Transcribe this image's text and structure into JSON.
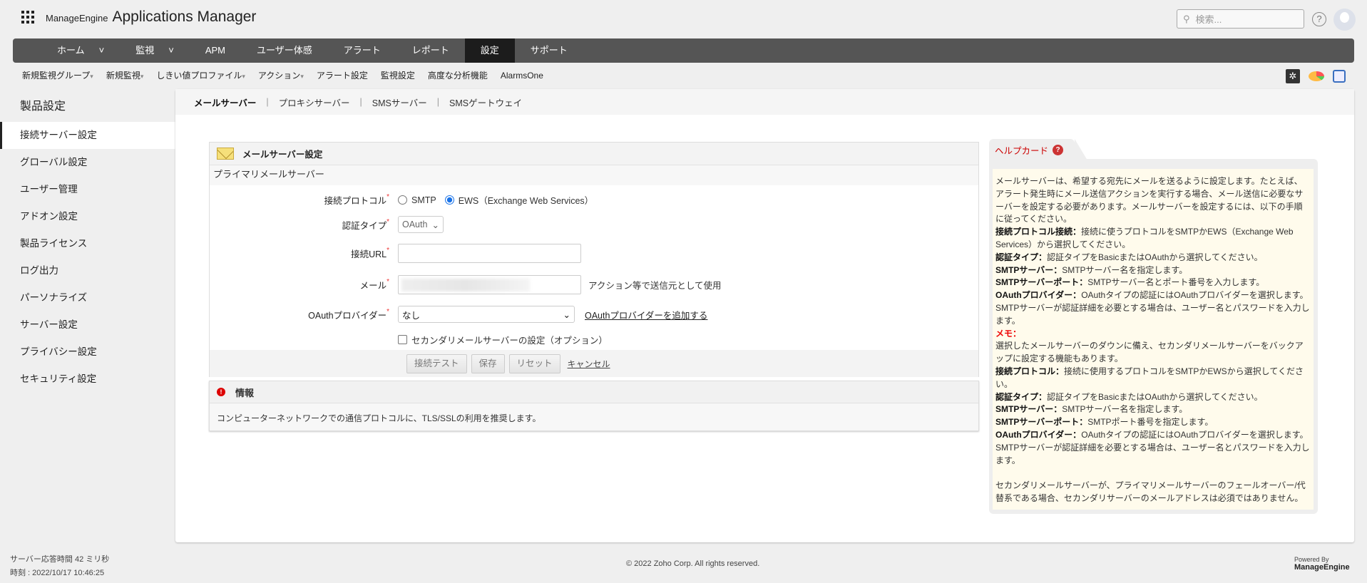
{
  "header": {
    "brand": "ManageEngine",
    "product": "Applications Manager",
    "search_placeholder": "検索...",
    "help": "?"
  },
  "nav": [
    {
      "label": "ホーム",
      "caret": "˅"
    },
    {
      "label": "監視",
      "caret": "˅"
    },
    {
      "label": "APM"
    },
    {
      "label": "ユーザー体感"
    },
    {
      "label": "アラート"
    },
    {
      "label": "レポート"
    },
    {
      "label": "設定",
      "active": true
    },
    {
      "label": "サポート"
    }
  ],
  "submenu": [
    {
      "label": "新規監視グループ",
      "caret": "▾"
    },
    {
      "label": "新規監視",
      "caret": "▾"
    },
    {
      "label": "しきい値プロファイル",
      "caret": "▾"
    },
    {
      "label": "アクション",
      "caret": "▾"
    },
    {
      "label": "アラート設定"
    },
    {
      "label": "監視設定"
    },
    {
      "label": "高度な分析機能"
    },
    {
      "label": "AlarmsOne"
    }
  ],
  "sidebar": {
    "title": "製品設定",
    "items": [
      "接続サーバー設定",
      "グローバル設定",
      "ユーザー管理",
      "アドオン設定",
      "製品ライセンス",
      "ログ出力",
      "パーソナライズ",
      "サーバー設定",
      "プライバシー設定",
      "セキュリティ設定"
    ]
  },
  "tabs": [
    "メールサーバー",
    "プロキシサーバー",
    "SMSサーバー",
    "SMSゲートウェイ"
  ],
  "tab_sep": "|",
  "form": {
    "title": "メールサーバー設定",
    "section": "プライマリメールサーバー",
    "required": "*",
    "protocol_label": "接続プロトコル",
    "protocol_smtp": "SMTP",
    "protocol_ews": "EWS（Exchange Web Services）",
    "auth_label": "認証タイプ",
    "auth_value": "OAuth",
    "caret": "⌄",
    "url_label": "接続URL",
    "mail_label": "メール",
    "mail_hint": "アクション等で送信元として使用",
    "oauth_label": "OAuthプロバイダー",
    "oauth_value": "なし",
    "oauth_add": "OAuthプロバイダーを追加する",
    "secondary": "セカンダリメールサーバーの設定（オプション）",
    "buttons": {
      "test": "接続テスト",
      "save": "保存",
      "reset": "リセット",
      "cancel": "キャンセル"
    }
  },
  "info": {
    "title": "情報",
    "icon": "!",
    "text": "コンピューターネットワークでの通信プロトコルに、TLS/SSLの利用を推奨します。"
  },
  "helpcard": {
    "title": "ヘルプカード",
    "icon": "?",
    "paras": [
      {
        "t": "メールサーバーは、希望する宛先にメールを送るように設定します。たとえば、アラート発生時にメール送信アクションを実行する場合、メール送信に必要なサーバーを設定する必要があります。メールサーバーを設定するには、以下の手順に従ってください。"
      },
      {
        "b": "接続プロトコル接続：",
        "t": "接続に使うプロトコルをSMTPかEWS（Exchange Web Services）から選択してください。"
      },
      {
        "b": "認証タイプ：",
        "t": "認証タイプをBasicまたはOAuthから選択してください。"
      },
      {
        "b": "SMTPサーバー：",
        "t": "SMTPサーバー名を指定します。"
      },
      {
        "b": "SMTPサーバーポート：",
        "t": "SMTPサーバー名とポート番号を入力します。"
      },
      {
        "b": "OAuthプロバイダー：",
        "t": "OAuthタイプの認証にはOAuthプロバイダーを選択します。SMTPサーバーが認証詳細を必要とする場合は、ユーザー名とパスワードを入力します。"
      },
      {
        "r": "メモ："
      },
      {
        "t": "選択したメールサーバーのダウンに備え、セカンダリメールサーバーをバックアップに設定する機能もあります。"
      },
      {
        "b": "接続プロトコル：",
        "t": "接続に使用するプロトコルをSMTPかEWSから選択してください。"
      },
      {
        "b": "認証タイプ：",
        "t": "認証タイプをBasicまたはOAuthから選択してください。"
      },
      {
        "b": "SMTPサーバー：",
        "t": "SMTPサーバー名を指定します。"
      },
      {
        "b": "SMTPサーバーポート：",
        "t": "SMTPポート番号を指定します。"
      },
      {
        "b": "OAuthプロバイダー：",
        "t": "OAuthタイプの認証にはOAuthプロバイダーを選択します。SMTPサーバーが認証詳細を必要とする場合は、ユーザー名とパスワードを入力します。"
      },
      {
        "t": " "
      },
      {
        "t": "セカンダリメールサーバーが、プライマリメールサーバーのフェールオーバー/代替系である場合、セカンダリサーバーのメールアドレスは必須ではありません。"
      }
    ]
  },
  "footer": {
    "response": "サーバー応答時間 42 ミリ秒",
    "time": "時刻 : 2022/10/17 10:46:25",
    "copyright": "© 2022 Zoho Corp.   All rights reserved.",
    "powered": "Powered By",
    "powered_brand": "ManageEngine"
  }
}
